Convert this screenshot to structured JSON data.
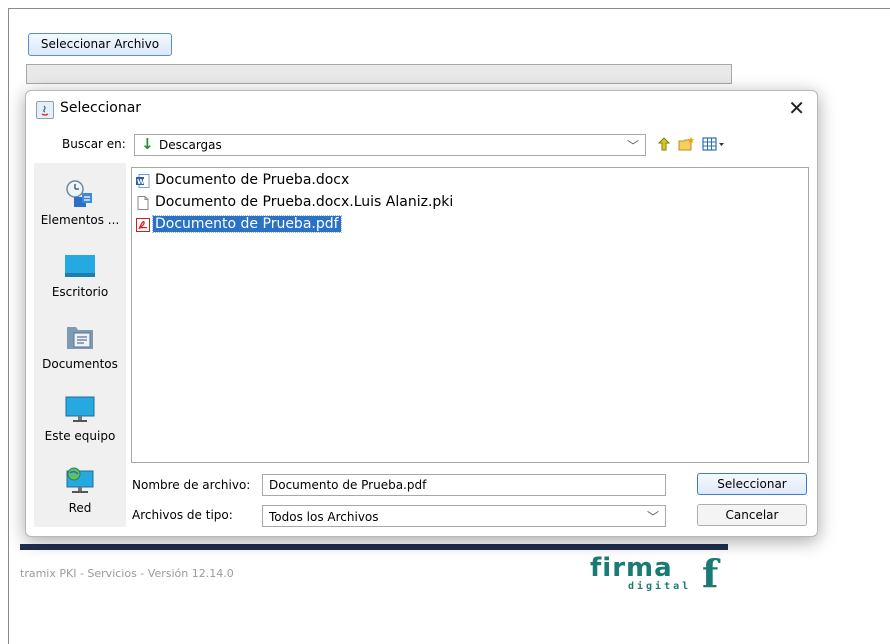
{
  "app": {
    "select_file_button": "Seleccionar Archivo",
    "footer_version": "tramix PKI - Servicios - Versión 12.14.0",
    "logo_main": "firma",
    "logo_sub": "digital",
    "logo_mark": "f"
  },
  "dialog": {
    "title": "Seleccionar",
    "close": "✕",
    "look_in_label": "Buscar en:",
    "look_in_value": "Descargas",
    "toolbar_icons": [
      "up-folder-icon",
      "new-folder-icon",
      "view-menu-icon"
    ],
    "places": [
      {
        "label": "Elementos ...",
        "icon": "recent-items-icon"
      },
      {
        "label": "Escritorio",
        "icon": "desktop-icon"
      },
      {
        "label": "Documentos",
        "icon": "documents-folder-icon"
      },
      {
        "label": "Este equipo",
        "icon": "computer-icon"
      },
      {
        "label": "Red",
        "icon": "network-icon"
      }
    ],
    "files": [
      {
        "name": "Documento de Prueba.docx",
        "icon": "word-document-icon",
        "selected": false
      },
      {
        "name": "Documento de Prueba.docx.Luis Alaniz.pki",
        "icon": "generic-file-icon",
        "selected": false
      },
      {
        "name": "Documento de Prueba.pdf",
        "icon": "pdf-file-icon",
        "selected": true
      }
    ],
    "file_name_label": "Nombre de archivo:",
    "file_name_value": "Documento de Prueba.pdf",
    "file_type_label": "Archivos de tipo:",
    "file_type_value": "Todos los Archivos",
    "approve_button": "Seleccionar",
    "cancel_button": "Cancelar"
  },
  "colors": {
    "selection": "#2a72c8",
    "brand": "#1b7a73",
    "footer_rule": "#1f3050"
  }
}
